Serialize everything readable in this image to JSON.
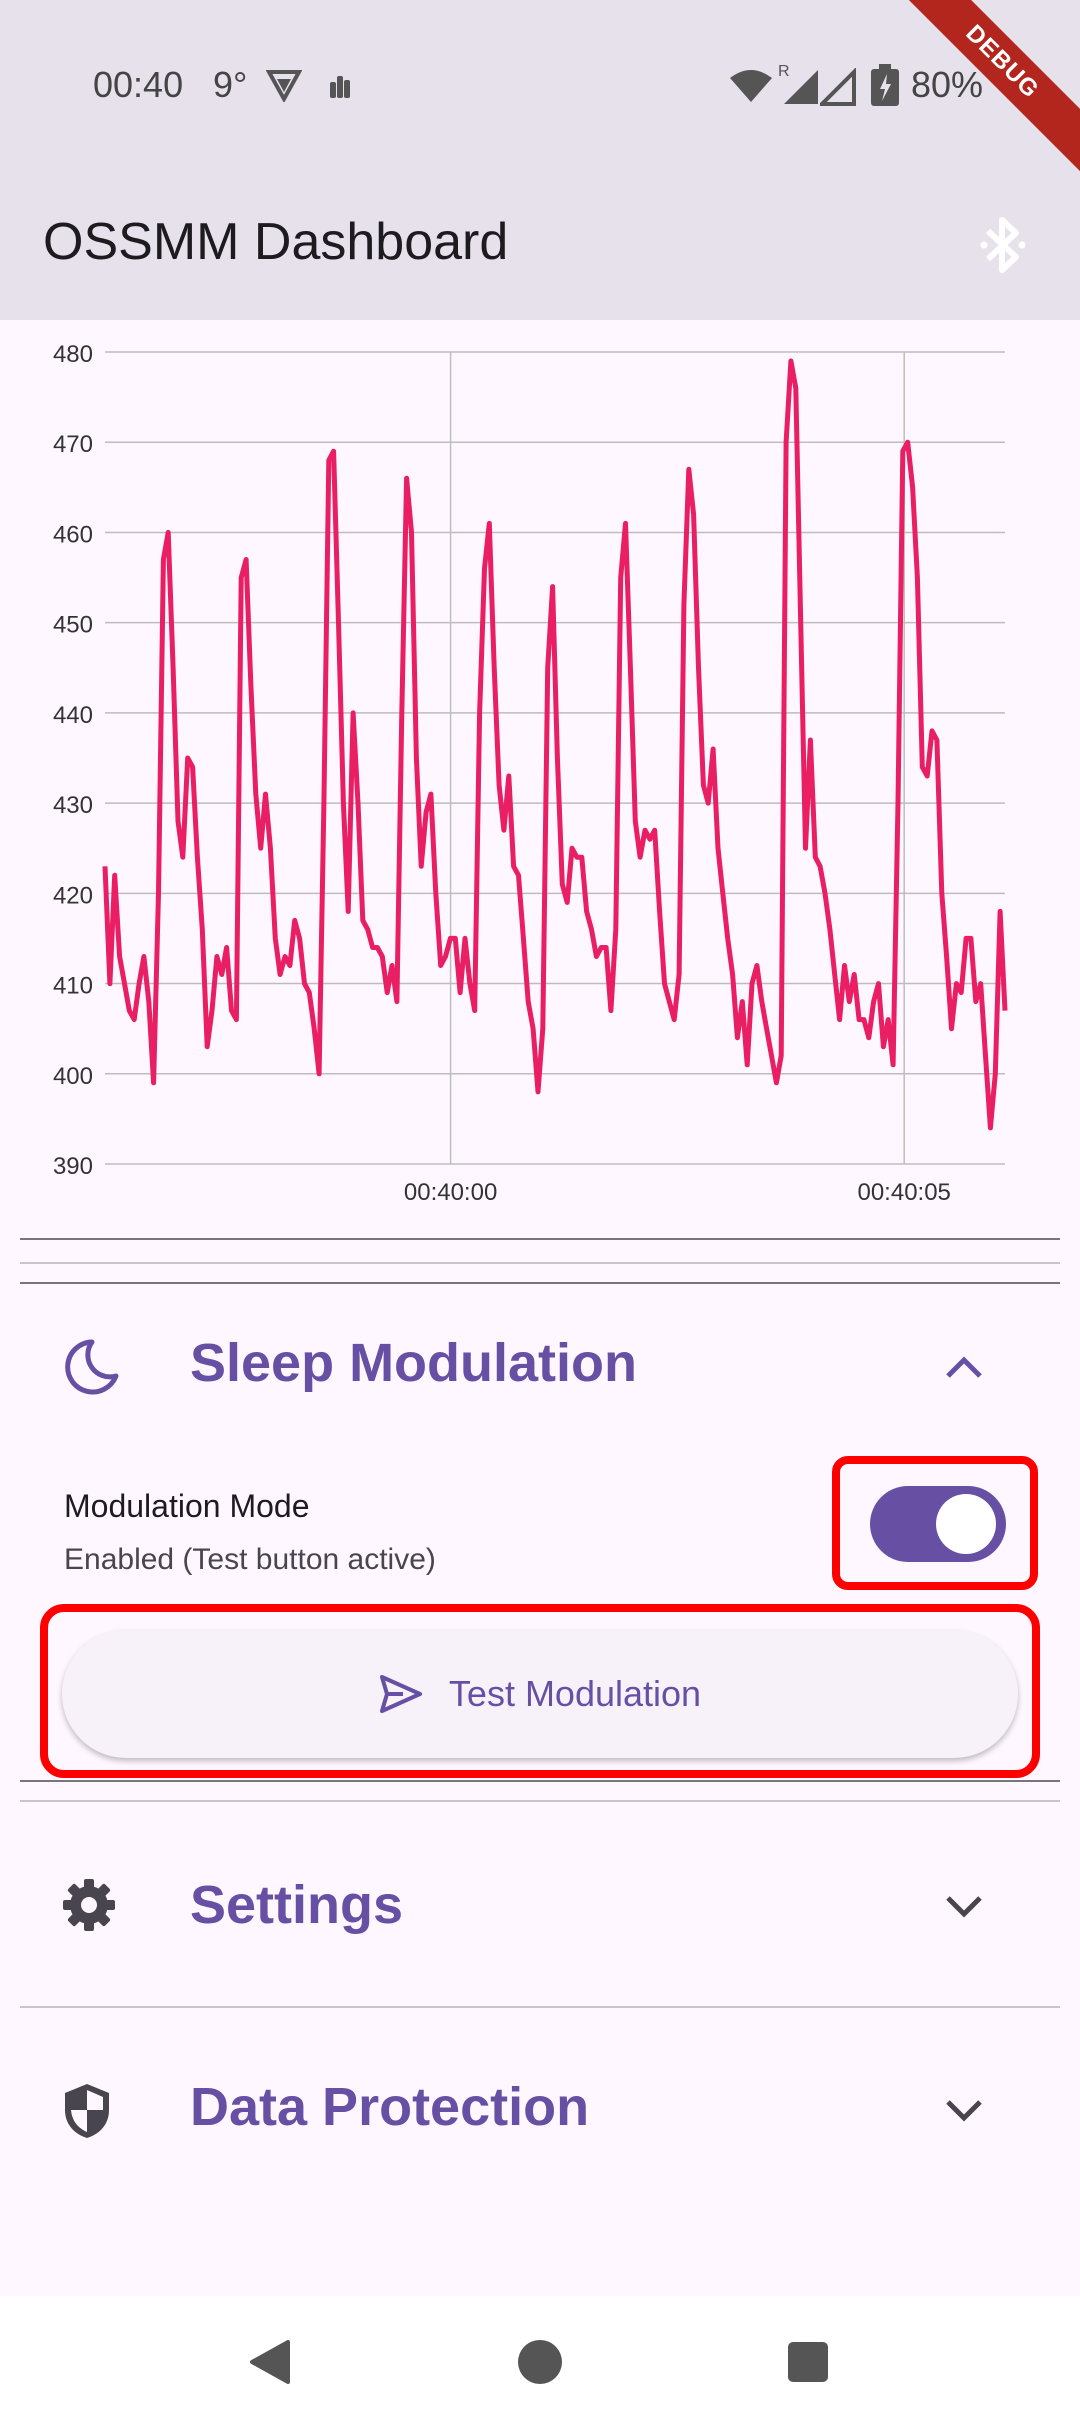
{
  "status_bar": {
    "time": "00:40",
    "temperature": "9°",
    "battery": "80%",
    "icons": [
      "vpn-icon",
      "notification-icon",
      "wifi-icon",
      "roaming-signal-icon",
      "signal-icon",
      "battery-icon"
    ]
  },
  "debug_banner": "DEBUG",
  "app_bar": {
    "title": "OSSMM Dashboard",
    "action_icon": "bluetooth-icon"
  },
  "chart_data": {
    "type": "line",
    "title": "",
    "xlabel": "",
    "ylabel": "",
    "ylim": [
      390,
      480
    ],
    "y_ticks": [
      480,
      470,
      460,
      450,
      440,
      430,
      420,
      410,
      400,
      390
    ],
    "x_ticks": [
      "00:40:00",
      "00:40:05"
    ],
    "grid": true,
    "color": "#e91e63",
    "series": [
      {
        "values": [
          423,
          410,
          422,
          413,
          410,
          407,
          406,
          410,
          413,
          408,
          399,
          420,
          457,
          460,
          445,
          428,
          424,
          435,
          434,
          424,
          416,
          403,
          407,
          413,
          411,
          414,
          407,
          406,
          455,
          457,
          443,
          431,
          425,
          431,
          425,
          415,
          411,
          413,
          412,
          417,
          415,
          410,
          409,
          405,
          400,
          430,
          468,
          469,
          450,
          430,
          418,
          440,
          430,
          417,
          416,
          414,
          414,
          413,
          409,
          412,
          408,
          440,
          466,
          460,
          435,
          423,
          429,
          431,
          420,
          412,
          413,
          415,
          415,
          409,
          415,
          410,
          407,
          440,
          456,
          461,
          445,
          432,
          427,
          433,
          423,
          422,
          415,
          408,
          405,
          398,
          405,
          445,
          454,
          435,
          421,
          419,
          425,
          424,
          424,
          418,
          416,
          413,
          414,
          414,
          407,
          416,
          455,
          461,
          445,
          428,
          424,
          427,
          426,
          427,
          418,
          410,
          408,
          406,
          411,
          452,
          467,
          462,
          445,
          432,
          430,
          436,
          425,
          420,
          415,
          411,
          404,
          408,
          401,
          410,
          412,
          408,
          405,
          402,
          399,
          402,
          470,
          479,
          476,
          450,
          425,
          437,
          424,
          423,
          420,
          416,
          411,
          406,
          412,
          408,
          411,
          406,
          406,
          404,
          408,
          410,
          403,
          406,
          401,
          430,
          469,
          470,
          465,
          455,
          434,
          433,
          438,
          437,
          420,
          413,
          405,
          410,
          409,
          415,
          415,
          408,
          410,
          402,
          394,
          400,
          418,
          407
        ]
      }
    ]
  },
  "sections": [
    {
      "title": "Sleep Modulation",
      "icon": "moon-icon",
      "expanded": true,
      "mode_label": "Modulation Mode",
      "mode_status": "Enabled (Test button active)",
      "toggle_on": true,
      "test_button_label": "Test Modulation",
      "test_button_icon": "send-icon"
    },
    {
      "title": "Settings",
      "icon": "gear-icon",
      "expanded": false
    },
    {
      "title": "Data Protection",
      "icon": "shield-icon",
      "expanded": false
    }
  ],
  "nav_bar": [
    "back-icon",
    "home-icon",
    "recents-icon"
  ],
  "colors": {
    "accent": "#6750a4",
    "line": "#e91e63",
    "highlight": "#ff0000"
  }
}
